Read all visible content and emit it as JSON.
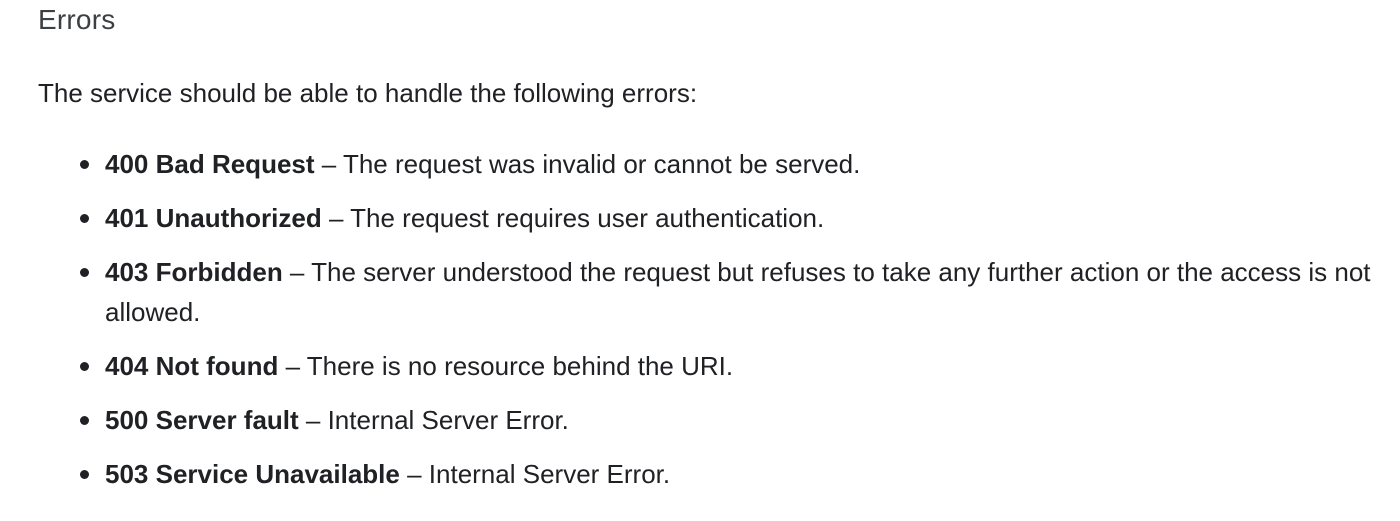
{
  "section": {
    "title": "Errors",
    "intro": "The service should be able to handle the following errors:"
  },
  "errors": [
    {
      "code": "400 Bad Request",
      "description": " – The request was invalid or cannot be served."
    },
    {
      "code": "401 Unauthorized",
      "description": " – The request requires user authentication."
    },
    {
      "code": "403 Forbidden",
      "description": " – The server understood the request but refuses to take any further action or the access is not allowed."
    },
    {
      "code": "404 Not found",
      "description": " – There is no resource behind the URI."
    },
    {
      "code": "500 Server fault",
      "description": " – Internal Server Error."
    },
    {
      "code": "503 Service Unavailable",
      "description": " – Internal Server Error."
    }
  ]
}
